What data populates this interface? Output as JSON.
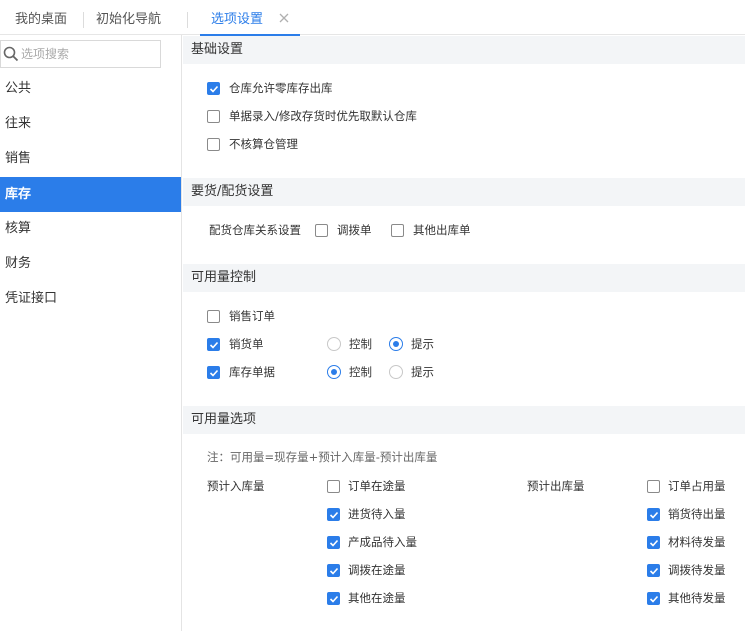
{
  "tabs": [
    {
      "label": "我的桌面"
    },
    {
      "label": "初始化导航"
    },
    {
      "label": "选项设置"
    }
  ],
  "sidebar": {
    "search_placeholder": "选项搜索",
    "items": [
      {
        "label": "公共"
      },
      {
        "label": "往来"
      },
      {
        "label": "销售"
      },
      {
        "label": "库存"
      },
      {
        "label": "核算"
      },
      {
        "label": "财务"
      },
      {
        "label": "凭证接口"
      }
    ],
    "active_item": "库存"
  },
  "sections": {
    "basic": {
      "title": "基础设置",
      "options": [
        {
          "label": "仓库允许零库存出库",
          "checked": true
        },
        {
          "label": "单据录入/修改存货时优先取默认仓库",
          "checked": false
        },
        {
          "label": "不核算仓管理",
          "checked": false
        }
      ]
    },
    "allocation": {
      "title": "要货/配货设置",
      "row_label": "配货仓库关系设置",
      "options": [
        {
          "label": "调拨单",
          "checked": false
        },
        {
          "label": "其他出库单",
          "checked": false
        }
      ]
    },
    "available_control": {
      "title": "可用量控制",
      "control_label": "控制",
      "hint_label": "提示",
      "rows": [
        {
          "label": "销售订单",
          "checked": false
        },
        {
          "label": "销货单",
          "checked": true,
          "mode": "提示"
        },
        {
          "label": "库存单据",
          "checked": true,
          "mode": "控制"
        }
      ]
    },
    "available_options": {
      "title": "可用量选项",
      "note": "注：可用量=现存量+预计入库量-预计出库量",
      "inbound_label": "预计入库量",
      "outbound_label": "预计出库量",
      "inbound": [
        {
          "label": "订单在途量",
          "checked": false
        },
        {
          "label": "进货待入量",
          "checked": true
        },
        {
          "label": "产成品待入量",
          "checked": true
        },
        {
          "label": "调拨在途量",
          "checked": true
        },
        {
          "label": "其他在途量",
          "checked": true
        }
      ],
      "outbound": [
        {
          "label": "订单占用量",
          "checked": false
        },
        {
          "label": "销货待出量",
          "checked": true
        },
        {
          "label": "材料待发量",
          "checked": true
        },
        {
          "label": "调拨待发量",
          "checked": true
        },
        {
          "label": "其他待发量",
          "checked": true
        }
      ]
    }
  },
  "colors": {
    "accent": "#2b7de9"
  }
}
